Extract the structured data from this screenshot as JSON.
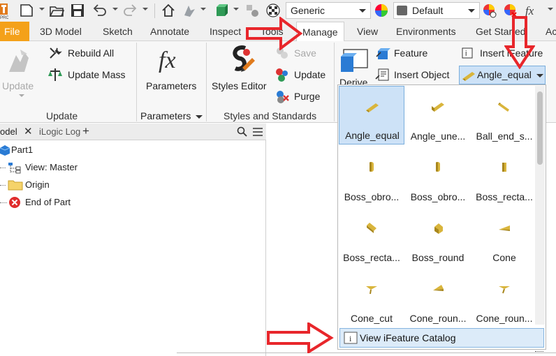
{
  "quick_access": {
    "material_combo": "Generic",
    "appearance_combo": "Default"
  },
  "tabs": [
    {
      "label": "File"
    },
    {
      "label": "3D Model"
    },
    {
      "label": "Sketch"
    },
    {
      "label": "Annotate"
    },
    {
      "label": "Inspect"
    },
    {
      "label": "Tools"
    },
    {
      "label": "Manage"
    },
    {
      "label": "View"
    },
    {
      "label": "Environments"
    },
    {
      "label": "Get Started"
    },
    {
      "label": "Ac"
    }
  ],
  "ribbon": {
    "update_group": {
      "update_label": "Update",
      "rebuild_all": "Rebuild All",
      "update_mass": "Update Mass",
      "panel_label": "Update"
    },
    "parameters_group": {
      "parameters_label": "Parameters",
      "panel_label": "Parameters"
    },
    "styles_group": {
      "styles_editor": "Styles Editor",
      "save": "Save",
      "update": "Update",
      "purge": "Purge",
      "panel_label": "Styles and Standards"
    },
    "insert_group": {
      "derive": "Derive",
      "feature": "Feature",
      "insert_object": "Insert Object",
      "insert_ifeature": "Insert iFeature",
      "selected_feature": "Angle_equal"
    }
  },
  "browser": {
    "tabs": [
      {
        "label": "odel"
      },
      {
        "label": "iLogic Log"
      }
    ],
    "tree": [
      {
        "label": "Part1"
      },
      {
        "label": "View: Master"
      },
      {
        "label": "Origin"
      },
      {
        "label": "End of Part"
      }
    ]
  },
  "gallery": {
    "items": [
      {
        "label": "Angle_equal",
        "icon": "angle-equal-icon",
        "selected": true
      },
      {
        "label": "Angle_une...",
        "icon": "angle-unequal-icon"
      },
      {
        "label": "Ball_end_s...",
        "icon": "ball-end-slot-icon"
      },
      {
        "label": "Boss_obro...",
        "icon": "boss-oblong-icon"
      },
      {
        "label": "Boss_obro...",
        "icon": "boss-oblong-icon"
      },
      {
        "label": "Boss_recta...",
        "icon": "boss-rectangular-icon"
      },
      {
        "label": "Boss_recta...",
        "icon": "boss-rectangular-icon"
      },
      {
        "label": "Boss_round",
        "icon": "boss-round-icon"
      },
      {
        "label": "Cone",
        "icon": "cone-icon"
      },
      {
        "label": "Cone_cut",
        "icon": "cone-cut-icon"
      },
      {
        "label": "Cone_roun...",
        "icon": "cone-round-icon"
      },
      {
        "label": "Cone_roun...",
        "icon": "cone-round-icon"
      }
    ],
    "catalog_link": "View iFeature Catalog"
  },
  "colors": {
    "file_tab": "#f4a11a",
    "annotation_arrow": "#e8262b",
    "selection": "#cde2f7",
    "gold": "#d9b53c"
  }
}
